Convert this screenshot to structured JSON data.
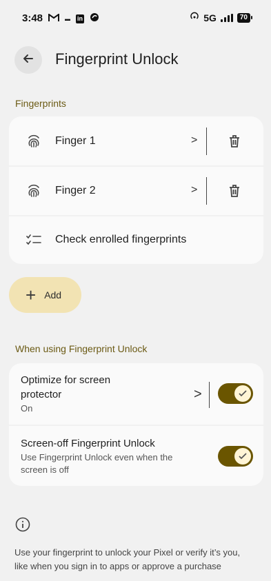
{
  "status_bar": {
    "time": "3:48",
    "left_icons": [
      "gmail-icon",
      "airtel-icon",
      "linkedin-icon",
      "app-icon"
    ],
    "network": "5G",
    "battery": "70"
  },
  "header": {
    "title": "Fingerprint Unlock"
  },
  "fingerprints": {
    "section_label": "Fingerprints",
    "items": [
      {
        "label": "Finger 1"
      },
      {
        "label": "Finger 2"
      }
    ],
    "check_label": "Check enrolled fingerprints",
    "add_label": "Add"
  },
  "usage": {
    "section_label": "When using Fingerprint Unlock",
    "settings": [
      {
        "title_line1": "Optimize for screen",
        "title_line2": "protector",
        "subtitle": "On",
        "enabled": true
      },
      {
        "title": "Screen-off Fingerprint Unlock",
        "subtitle_line1": "Use Fingerprint Unlock even when the",
        "subtitle_line2": "screen is off",
        "enabled": true
      }
    ]
  },
  "footer": {
    "line1": "Use your fingerprint to unlock your Pixel or verify it’s you,",
    "line2": "like when you sign in to apps or approve a purchase"
  },
  "colors": {
    "accent": "#6a5500",
    "section_label": "#6b5a14",
    "add_button": "#f2e3b3"
  }
}
